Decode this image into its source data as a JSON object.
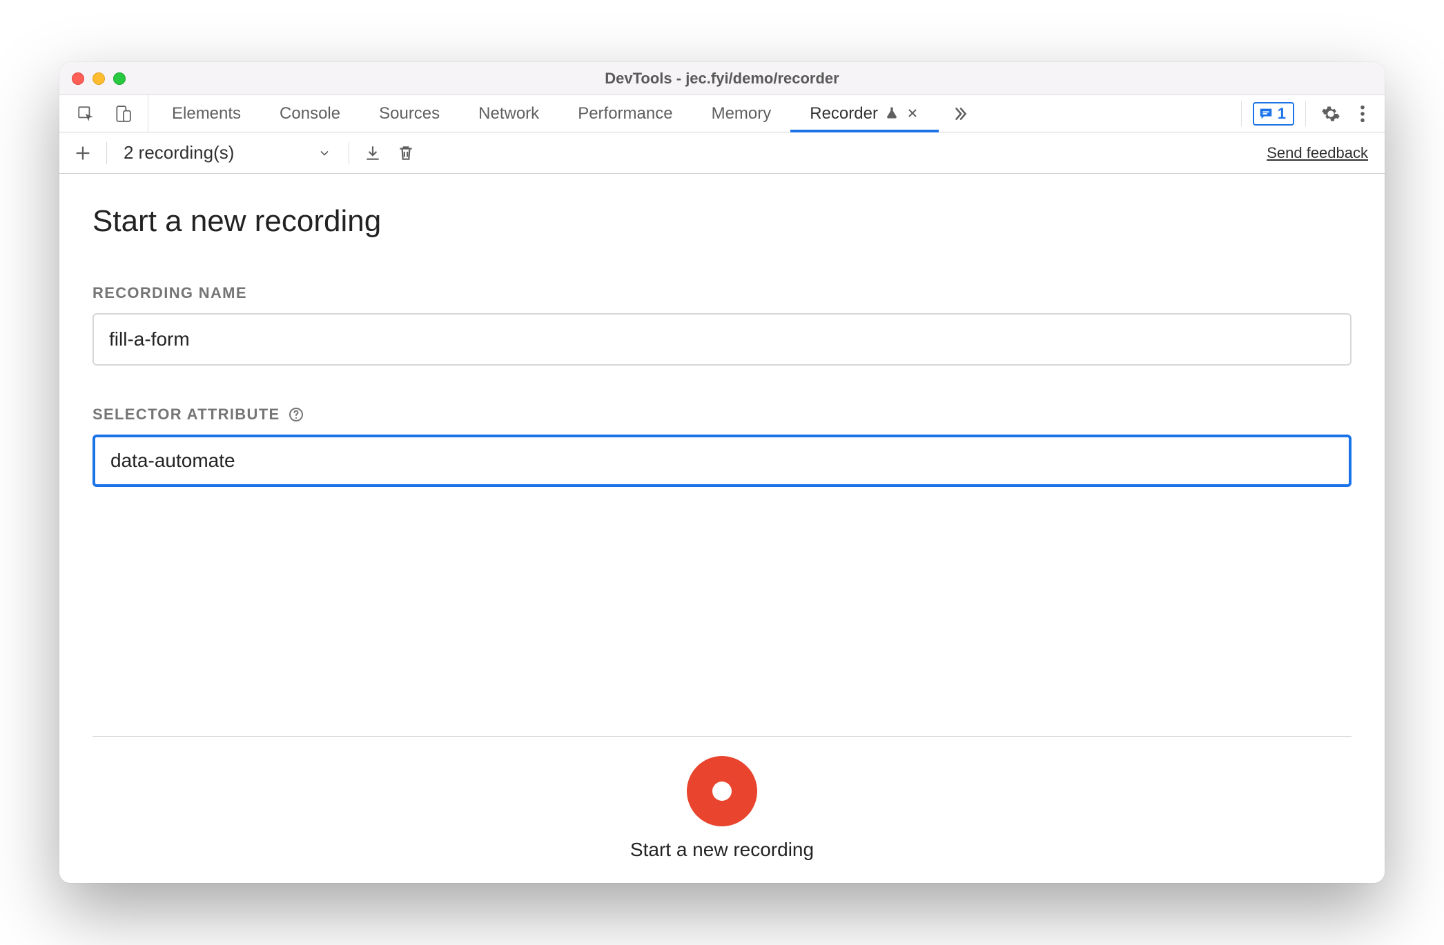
{
  "window": {
    "title": "DevTools - jec.fyi/demo/recorder"
  },
  "tabs": {
    "items": [
      {
        "label": "Elements",
        "active": false
      },
      {
        "label": "Console",
        "active": false
      },
      {
        "label": "Sources",
        "active": false
      },
      {
        "label": "Network",
        "active": false
      },
      {
        "label": "Performance",
        "active": false
      },
      {
        "label": "Memory",
        "active": false
      },
      {
        "label": "Recorder",
        "active": true,
        "experiment": true,
        "closable": true
      }
    ],
    "issues_count": "1"
  },
  "toolbar": {
    "recordings_label": "2 recording(s)",
    "feedback": "Send feedback"
  },
  "main": {
    "heading": "Start a new recording",
    "fields": {
      "recording_name_label": "RECORDING NAME",
      "recording_name_value": "fill-a-form",
      "selector_attribute_label": "SELECTOR ATTRIBUTE",
      "selector_attribute_value": "data-automate"
    },
    "footer_label": "Start a new recording"
  }
}
